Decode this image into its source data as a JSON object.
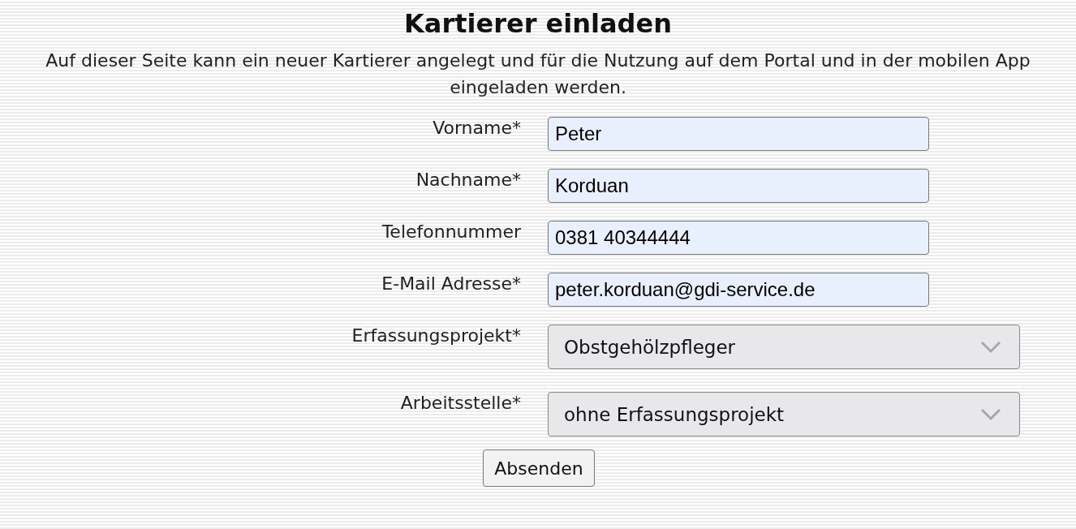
{
  "title": "Kartierer einladen",
  "description": "Auf dieser Seite kann ein neuer Kartierer angelegt und für die Nutzung auf dem Portal und in der mobilen App eingeladen werden.",
  "fields": [
    {
      "kind": "text",
      "label": "Vorname*",
      "value": "Peter"
    },
    {
      "kind": "text",
      "label": "Nachname*",
      "value": "Korduan"
    },
    {
      "kind": "text",
      "label": "Telefonnummer",
      "value": "0381 40344444"
    },
    {
      "kind": "text",
      "label": "E-Mail Adresse*",
      "value": "peter.korduan@gdi-service.de"
    },
    {
      "kind": "select",
      "label": "Erfassungsprojekt*",
      "value": "Obstgehölzpfleger"
    },
    {
      "kind": "select",
      "label": "Arbeitsstelle*",
      "value": "ohne Erfassungsprojekt"
    }
  ],
  "submit_button": "Absenden"
}
